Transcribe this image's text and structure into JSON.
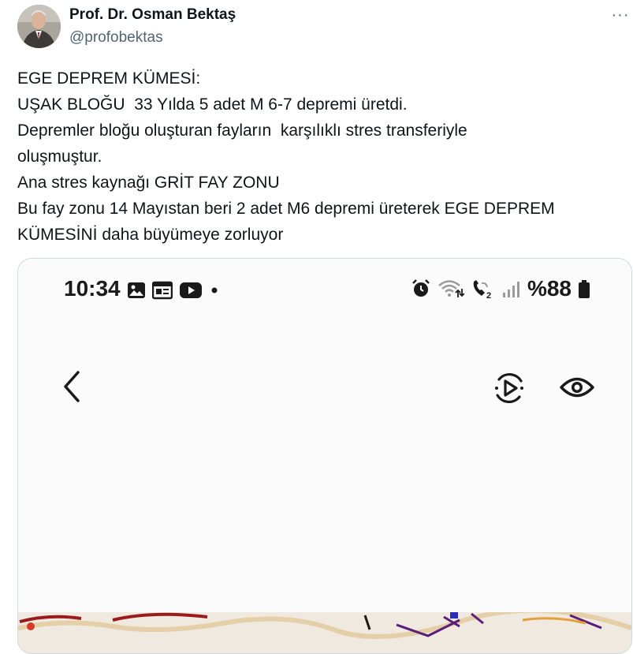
{
  "author": {
    "name": "Prof. Dr. Osman Bektaş",
    "handle": "@profobektas"
  },
  "more_label": "···",
  "tweet": {
    "lines": [
      "EGE DEPREM KÜMESİ:",
      "UŞAK BLOĞU  33 Yılda 5 adet M 6-7 depremi üretdi.",
      "Depremler bloğu oluşturan fayların  karşılıklı stres transferiyle",
      "oluşmuştur.",
      "Ana stres kaynağı GRİT FAY ZONU",
      "Bu fay zonu 14 Mayıstan beri 2 adet M6 depremi üreterek EGE DEPREM",
      "KÜMESİNİ daha büyümeye zorluyor"
    ]
  },
  "media": {
    "status_bar": {
      "time": "10:34",
      "battery": "%88",
      "left_icons": [
        "gallery-icon",
        "news-icon",
        "youtube-icon",
        "dot-icon"
      ],
      "right_icons": [
        "alarm-icon",
        "wifi-icon",
        "call-icon",
        "signal-icon",
        "battery-icon"
      ]
    },
    "toolbar_icons": [
      "back-icon",
      "motion-play-icon",
      "eye-icon"
    ]
  },
  "colors": {
    "text": "#0f1419",
    "secondary": "#536471",
    "border": "#cfd9de",
    "map_fault_red": "#9a1b1b",
    "map_fault_purple": "#5a1d7a"
  }
}
